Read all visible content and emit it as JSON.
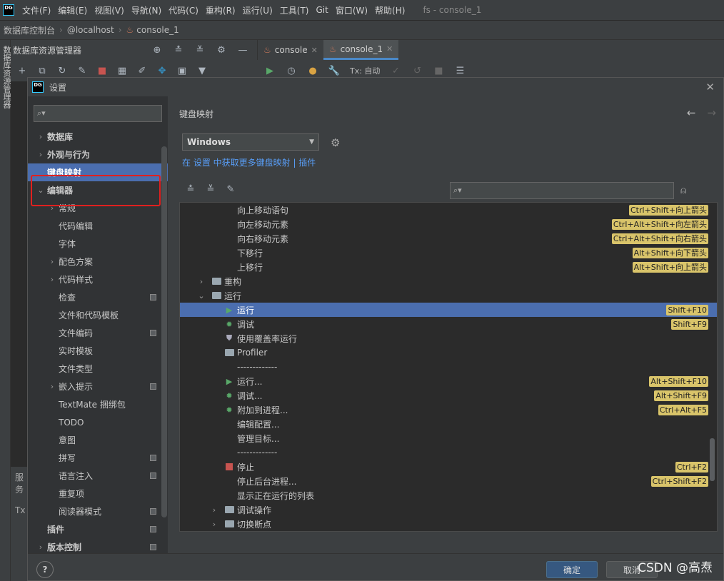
{
  "menubar": {
    "logo": "DG",
    "items": [
      "文件(F)",
      "编辑(E)",
      "视图(V)",
      "导航(N)",
      "代码(C)",
      "重构(R)",
      "运行(U)",
      "工具(T)",
      "Git",
      "窗口(W)",
      "帮助(H)"
    ],
    "window_title": "fs - console_1"
  },
  "breadcrumb": {
    "items": [
      "数据库控制台",
      "@localhost",
      "console_1"
    ]
  },
  "side_stripe": {
    "label": "数据库资源管理器"
  },
  "explorer": {
    "title": "数据库资源管理器"
  },
  "editor_tabs": [
    {
      "label": "console"
    },
    {
      "label": "console_1"
    }
  ],
  "editor_toolbar": {
    "tx_label": "Tx: 自动"
  },
  "bottom_left": {
    "label1": "服务",
    "label2": "Tx"
  },
  "dialog": {
    "logo": "DG",
    "title": "设置",
    "tree_search_placeholder": "",
    "tree": [
      {
        "label": "数据库",
        "level": 0,
        "chevron": "›",
        "bold": true
      },
      {
        "label": "外观与行为",
        "level": 0,
        "chevron": "›",
        "bold": true
      },
      {
        "label": "键盘映射",
        "level": 0,
        "chevron": "",
        "bold": true,
        "selected": true
      },
      {
        "label": "编辑器",
        "level": 0,
        "chevron": "⌄",
        "bold": true
      },
      {
        "label": "常规",
        "level": 1,
        "chevron": "›"
      },
      {
        "label": "代码编辑",
        "level": 1,
        "chevron": ""
      },
      {
        "label": "字体",
        "level": 1,
        "chevron": ""
      },
      {
        "label": "配色方案",
        "level": 1,
        "chevron": "›"
      },
      {
        "label": "代码样式",
        "level": 1,
        "chevron": "›"
      },
      {
        "label": "检查",
        "level": 1,
        "chevron": "",
        "mark": true
      },
      {
        "label": "文件和代码模板",
        "level": 1,
        "chevron": ""
      },
      {
        "label": "文件编码",
        "level": 1,
        "chevron": "",
        "mark": true
      },
      {
        "label": "实时模板",
        "level": 1,
        "chevron": ""
      },
      {
        "label": "文件类型",
        "level": 1,
        "chevron": ""
      },
      {
        "label": "嵌入提示",
        "level": 1,
        "chevron": "›",
        "mark": true
      },
      {
        "label": "TextMate 捆绑包",
        "level": 1,
        "chevron": ""
      },
      {
        "label": "TODO",
        "level": 1,
        "chevron": ""
      },
      {
        "label": "意图",
        "level": 1,
        "chevron": ""
      },
      {
        "label": "拼写",
        "level": 1,
        "chevron": "",
        "mark": true
      },
      {
        "label": "语言注入",
        "level": 1,
        "chevron": "",
        "mark": true
      },
      {
        "label": "重复项",
        "level": 1,
        "chevron": ""
      },
      {
        "label": "阅读器模式",
        "level": 1,
        "chevron": "",
        "mark": true
      },
      {
        "label": "插件",
        "level": 0,
        "chevron": "",
        "bold": true,
        "mark": true
      },
      {
        "label": "版本控制",
        "level": 0,
        "chevron": "›",
        "bold": true,
        "mark": true
      }
    ],
    "keymap": {
      "title": "键盘映射",
      "selected_keymap": "Windows",
      "more_link": "在 设置 中获取更多键盘映射 | 插件",
      "search_placeholder": "",
      "rows": [
        {
          "label": "向上移动语句",
          "indent": 3,
          "icon": "",
          "shortcut": "Ctrl+Shift+向上箭头"
        },
        {
          "label": "向左移动元素",
          "indent": 3,
          "icon": "",
          "shortcut": "Ctrl+Alt+Shift+向左箭头"
        },
        {
          "label": "向右移动元素",
          "indent": 3,
          "icon": "",
          "shortcut": "Ctrl+Alt+Shift+向右箭头"
        },
        {
          "label": "下移行",
          "indent": 3,
          "icon": "",
          "shortcut": "Alt+Shift+向下箭头"
        },
        {
          "label": "上移行",
          "indent": 3,
          "icon": "",
          "shortcut": "Alt+Shift+向上箭头"
        },
        {
          "label": "重构",
          "indent": 1,
          "icon": "folder",
          "chevron": "›",
          "shortcut": ""
        },
        {
          "label": "运行",
          "indent": 1,
          "icon": "folder",
          "chevron": "⌄",
          "shortcut": ""
        },
        {
          "label": "运行",
          "indent": 2,
          "icon": "play",
          "shortcut": "Shift+F10",
          "selected": true
        },
        {
          "label": "调试",
          "indent": 2,
          "icon": "bug",
          "shortcut": "Shift+F9"
        },
        {
          "label": "使用覆盖率运行",
          "indent": 2,
          "icon": "shield",
          "shortcut": ""
        },
        {
          "label": "Profiler",
          "indent": 2,
          "icon": "folder",
          "shortcut": ""
        },
        {
          "label": "-------------",
          "indent": 3,
          "icon": "",
          "shortcut": ""
        },
        {
          "label": "运行...",
          "indent": 2,
          "icon": "play",
          "shortcut": "Alt+Shift+F10"
        },
        {
          "label": "调试...",
          "indent": 2,
          "icon": "bug",
          "shortcut": "Alt+Shift+F9"
        },
        {
          "label": "附加到进程...",
          "indent": 2,
          "icon": "bug",
          "shortcut": "Ctrl+Alt+F5"
        },
        {
          "label": "编辑配置...",
          "indent": 3,
          "icon": "",
          "shortcut": ""
        },
        {
          "label": "管理目标...",
          "indent": 3,
          "icon": "",
          "shortcut": ""
        },
        {
          "label": "-------------",
          "indent": 3,
          "icon": "",
          "shortcut": ""
        },
        {
          "label": "停止",
          "indent": 2,
          "icon": "stop",
          "shortcut": "Ctrl+F2"
        },
        {
          "label": "停止后台进程...",
          "indent": 3,
          "icon": "",
          "shortcut": "Ctrl+Shift+F2"
        },
        {
          "label": "显示正在运行的列表",
          "indent": 3,
          "icon": "",
          "shortcut": ""
        },
        {
          "label": "调试操作",
          "indent": 2,
          "icon": "folder",
          "chevron": "›",
          "shortcut": ""
        },
        {
          "label": "切换断点",
          "indent": 2,
          "icon": "folder",
          "chevron": "›",
          "shortcut": ""
        }
      ]
    },
    "buttons": {
      "help": "?",
      "ok": "确定",
      "cancel": "取消"
    }
  },
  "watermark": "CSDN @高焘",
  "colors": {
    "selection": "#4b6eaf",
    "shortcut_badge": "#d9c46a",
    "highlight_box": "#e0201f",
    "link": "#589df6"
  }
}
